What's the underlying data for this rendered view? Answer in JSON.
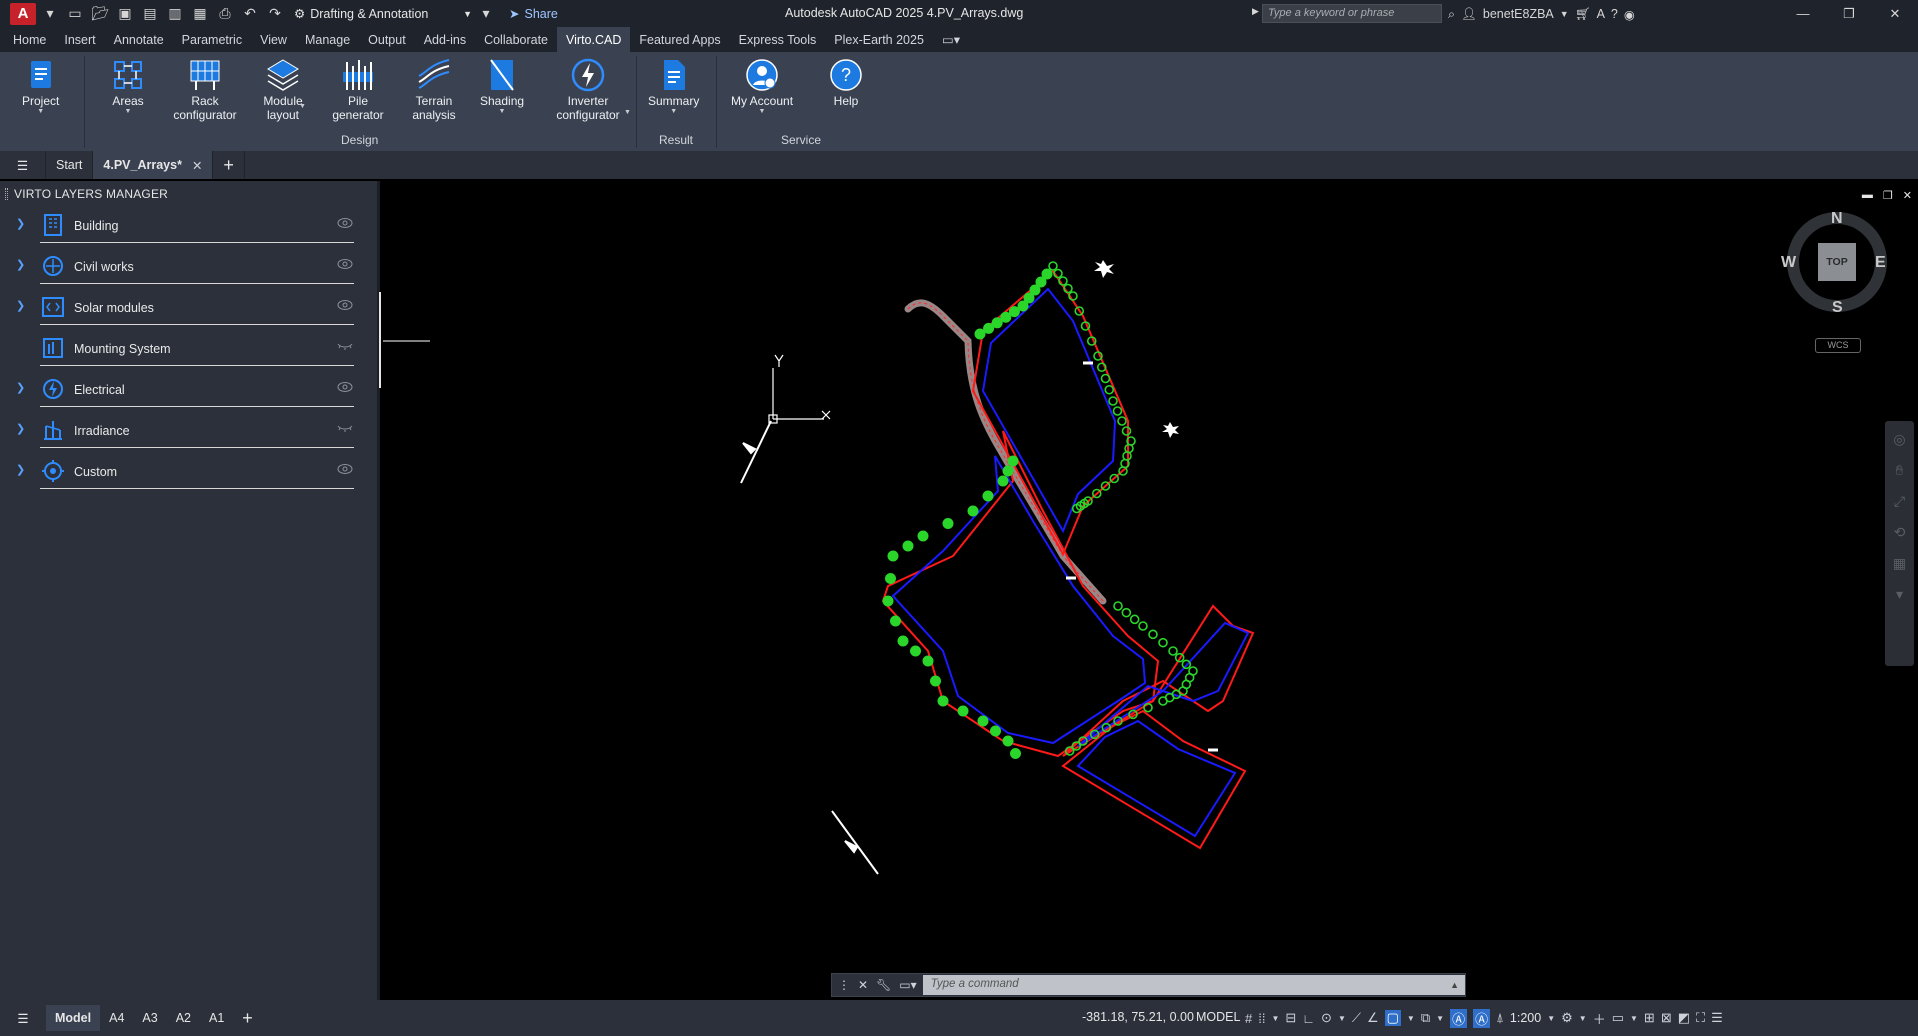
{
  "titlebar": {
    "logo": "A",
    "workspace": "Drafting & Annotation",
    "share": "Share",
    "app_title": "Autodesk AutoCAD 2025    4.PV_Arrays.dwg",
    "search_placeholder": "Type a keyword or phrase",
    "user": "benetE8ZBA"
  },
  "ribbon_tabs": [
    "Home",
    "Insert",
    "Annotate",
    "Parametric",
    "View",
    "Manage",
    "Output",
    "Add-ins",
    "Collaborate",
    "Virto.CAD",
    "Featured Apps",
    "Express Tools",
    "Plex-Earth 2025"
  ],
  "ribbon_active_tab": "Virto.CAD",
  "ribbon": {
    "project": "Project",
    "areas": "Areas",
    "rack_configurator": "Rack configurator",
    "module_layout": "Module layout",
    "pile_generator": "Pile generator",
    "terrain_analysis": "Terrain analysis",
    "shading": "Shading",
    "inverter_configurator": "Inverter configurator",
    "summary": "Summary",
    "my_account": "My Account",
    "help": "Help",
    "panel_design": "Design",
    "panel_result": "Result",
    "panel_service": "Service"
  },
  "file_tabs": {
    "start": "Start",
    "current": "4.PV_Arrays*"
  },
  "layers_manager": {
    "title": "VIRTO LAYERS MANAGER",
    "layers": [
      {
        "name": "Building",
        "expandable": true,
        "visible": true
      },
      {
        "name": "Civil works",
        "expandable": true,
        "visible": true
      },
      {
        "name": "Solar modules",
        "expandable": true,
        "visible": true
      },
      {
        "name": "Mounting System",
        "expandable": false,
        "visible": false
      },
      {
        "name": "Electrical",
        "expandable": true,
        "visible": true
      },
      {
        "name": "Irradiance",
        "expandable": true,
        "visible": false
      },
      {
        "name": "Custom",
        "expandable": true,
        "visible": true
      }
    ]
  },
  "viewcube": {
    "n": "N",
    "s": "S",
    "e": "E",
    "w": "W",
    "face": "TOP",
    "ucs": "WCS"
  },
  "ucs_icon": {
    "x": "X",
    "y": "Y"
  },
  "command_line": {
    "placeholder": "Type a command"
  },
  "statusbar": {
    "layout_tabs": [
      "Model",
      "A4",
      "A3",
      "A2",
      "A1"
    ],
    "active_layout": "Model",
    "coords": "-381.18, 75.21, 0.00",
    "space": "MODEL",
    "scale": "1:200"
  },
  "colors": {
    "accent": "#2f6fc9",
    "ribbon_bg": "#3a4150",
    "panel_bg": "#2b303a",
    "boundary_red": "#ff1a1a",
    "setback_blue": "#1a1aff",
    "trees_green": "#2bd62b",
    "road": "#9a8686"
  }
}
